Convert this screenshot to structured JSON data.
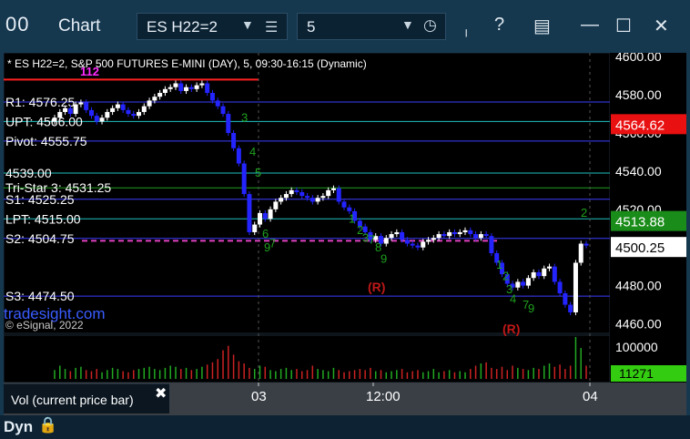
{
  "window": {
    "app_icon": "00",
    "title": "Chart",
    "symbol": "ES H22=2",
    "interval": "5",
    "icons": [
      "chevron-down-icon",
      "menu-icon",
      "clock-icon",
      "pin-icon",
      "help-icon",
      "layout-icon",
      "minimize-icon",
      "maximize-icon",
      "close-icon"
    ]
  },
  "chart_data": {
    "type": "candlestick",
    "header": "* ES H22=2, S&P 500 FUTURES E-MINI (DAY), 5, 09:30-16:15 (Dynamic)",
    "watermark": "tradesight.com",
    "copyright": "© eSignal, 2022",
    "ylim": [
      4455,
      4602
    ],
    "y_ticks": [
      4600,
      4580,
      4560,
      4540,
      4520,
      4500,
      4480,
      4460
    ],
    "x_ticks": [
      "03",
      "12:00",
      "04"
    ],
    "price_labels": [
      {
        "value": 4564.62,
        "text": "4564.62",
        "bg": "#e81010",
        "fg": "#ffffff"
      },
      {
        "value": 4513.88,
        "text": "4513.88",
        "bg": "#1a8c1a",
        "fg": "#ffffff"
      },
      {
        "value": 4500.25,
        "text": "4500.25",
        "bg": "#ffffff",
        "fg": "#000000"
      }
    ],
    "levels": [
      {
        "name": "R1",
        "label": "R1: 4576.25",
        "value": 4576.25,
        "color": "#3d3dff"
      },
      {
        "name": "UPT",
        "label": "UPT: 4566.00",
        "value": 4566.0,
        "color": "#20c0c0"
      },
      {
        "name": "Pivot",
        "label": "Pivot: 4555.75",
        "value": 4555.75,
        "color": "#3d3dff"
      },
      {
        "name": "",
        "label": "4539.00",
        "value": 4539.0,
        "color": "#20c0c0"
      },
      {
        "name": "Tri-Star 3",
        "label": "Tri-Star 3: 4531.25",
        "value": 4531.25,
        "color": "#20a020"
      },
      {
        "name": "S1",
        "label": "S1: 4525.25",
        "value": 4525.25,
        "color": "#3d3dff"
      },
      {
        "name": "LPT",
        "label": "LPT: 4515.00",
        "value": 4515.0,
        "color": "#20c0c0"
      },
      {
        "name": "S2",
        "label": "S2: 4504.75",
        "value": 4504.75,
        "color": "#3d3dff"
      },
      {
        "name": "S3",
        "label": "S3: 4474.50",
        "value": 4474.5,
        "color": "#3d3dff"
      }
    ],
    "top_marker": {
      "label": "112",
      "value": 4590,
      "color": "#ff2aff"
    },
    "high_line": {
      "value": 4588,
      "color": "#ff2020"
    },
    "dashed_line": {
      "value": 4503.5,
      "color": "#e040c0"
    },
    "annotations": [
      {
        "text": "(R)",
        "color": "#c01818",
        "value": 4477
      },
      {
        "text": "(R)",
        "color": "#c01818",
        "value": 4455
      }
    ],
    "seq_labels": [
      "3",
      "4",
      "5",
      "6",
      "7",
      "9",
      "1",
      "2",
      "3",
      "7",
      "8",
      "9",
      "1",
      "2",
      "3",
      "4",
      "7",
      "9",
      "2"
    ],
    "series": [
      {
        "name": "price",
        "values": [
          4568,
          4571,
          4573,
          4570,
          4575,
          4576,
          4572,
          4569,
          4566,
          4568,
          4571,
          4573,
          4575,
          4572,
          4570,
          4569,
          4571,
          4574,
          4577,
          4579,
          4581,
          4583,
          4584,
          4586,
          4582,
          4584,
          4583,
          4585,
          4586,
          4581,
          4577,
          4574,
          4570,
          4560,
          4552,
          4544,
          4528,
          4508,
          4512,
          4518,
          4515,
          4520,
          4524,
          4526,
          4528,
          4530,
          4529,
          4527,
          4526,
          4524,
          4526,
          4527,
          4530,
          4531,
          4524,
          4521,
          4519,
          4514,
          4511,
          4508,
          4504,
          4506,
          4502,
          4505,
          4507,
          4508,
          4504,
          4502,
          4501,
          4500,
          4503,
          4504,
          4505,
          4507,
          4506,
          4508,
          4507,
          4508,
          4509,
          4507,
          4505,
          4507,
          4506,
          4497,
          4492,
          4486,
          4481,
          4479,
          4482,
          4480,
          4484,
          4487,
          4485,
          4489,
          4490,
          4482,
          4476,
          4470,
          4466,
          4492,
          4502,
          4501
        ]
      },
      {
        "name": "volume",
        "values": [
          8,
          12,
          9,
          7,
          10,
          11,
          8,
          7,
          9,
          6,
          8,
          10,
          9,
          7,
          6,
          8,
          9,
          10,
          11,
          9,
          8,
          10,
          12,
          11,
          9,
          10,
          8,
          9,
          11,
          13,
          15,
          18,
          26,
          30,
          22,
          16,
          14,
          10,
          9,
          12,
          11,
          8,
          7,
          9,
          10,
          8,
          9,
          7,
          8,
          12,
          9,
          8,
          7,
          10,
          8,
          6,
          7,
          8,
          9,
          8,
          10,
          7,
          8,
          6,
          7,
          8,
          9,
          6,
          7,
          8,
          6,
          7,
          9,
          6,
          7,
          8,
          6,
          7,
          6,
          9,
          12,
          14,
          15,
          10,
          9,
          11,
          8,
          12,
          10,
          9,
          8,
          10,
          9,
          12,
          14,
          11,
          13,
          9,
          12,
          38,
          28,
          12
        ]
      }
    ],
    "volume_ticks": [
      {
        "value": "100000",
        "bg": "",
        "fg": "#ffffff"
      },
      {
        "value": "11271",
        "bg": "#33cc11",
        "fg": "#000000"
      }
    ]
  },
  "legend": {
    "label": "Vol (current price bar)",
    "close": "✖"
  },
  "status": {
    "mode": "Dyn",
    "lock": "🔒"
  }
}
